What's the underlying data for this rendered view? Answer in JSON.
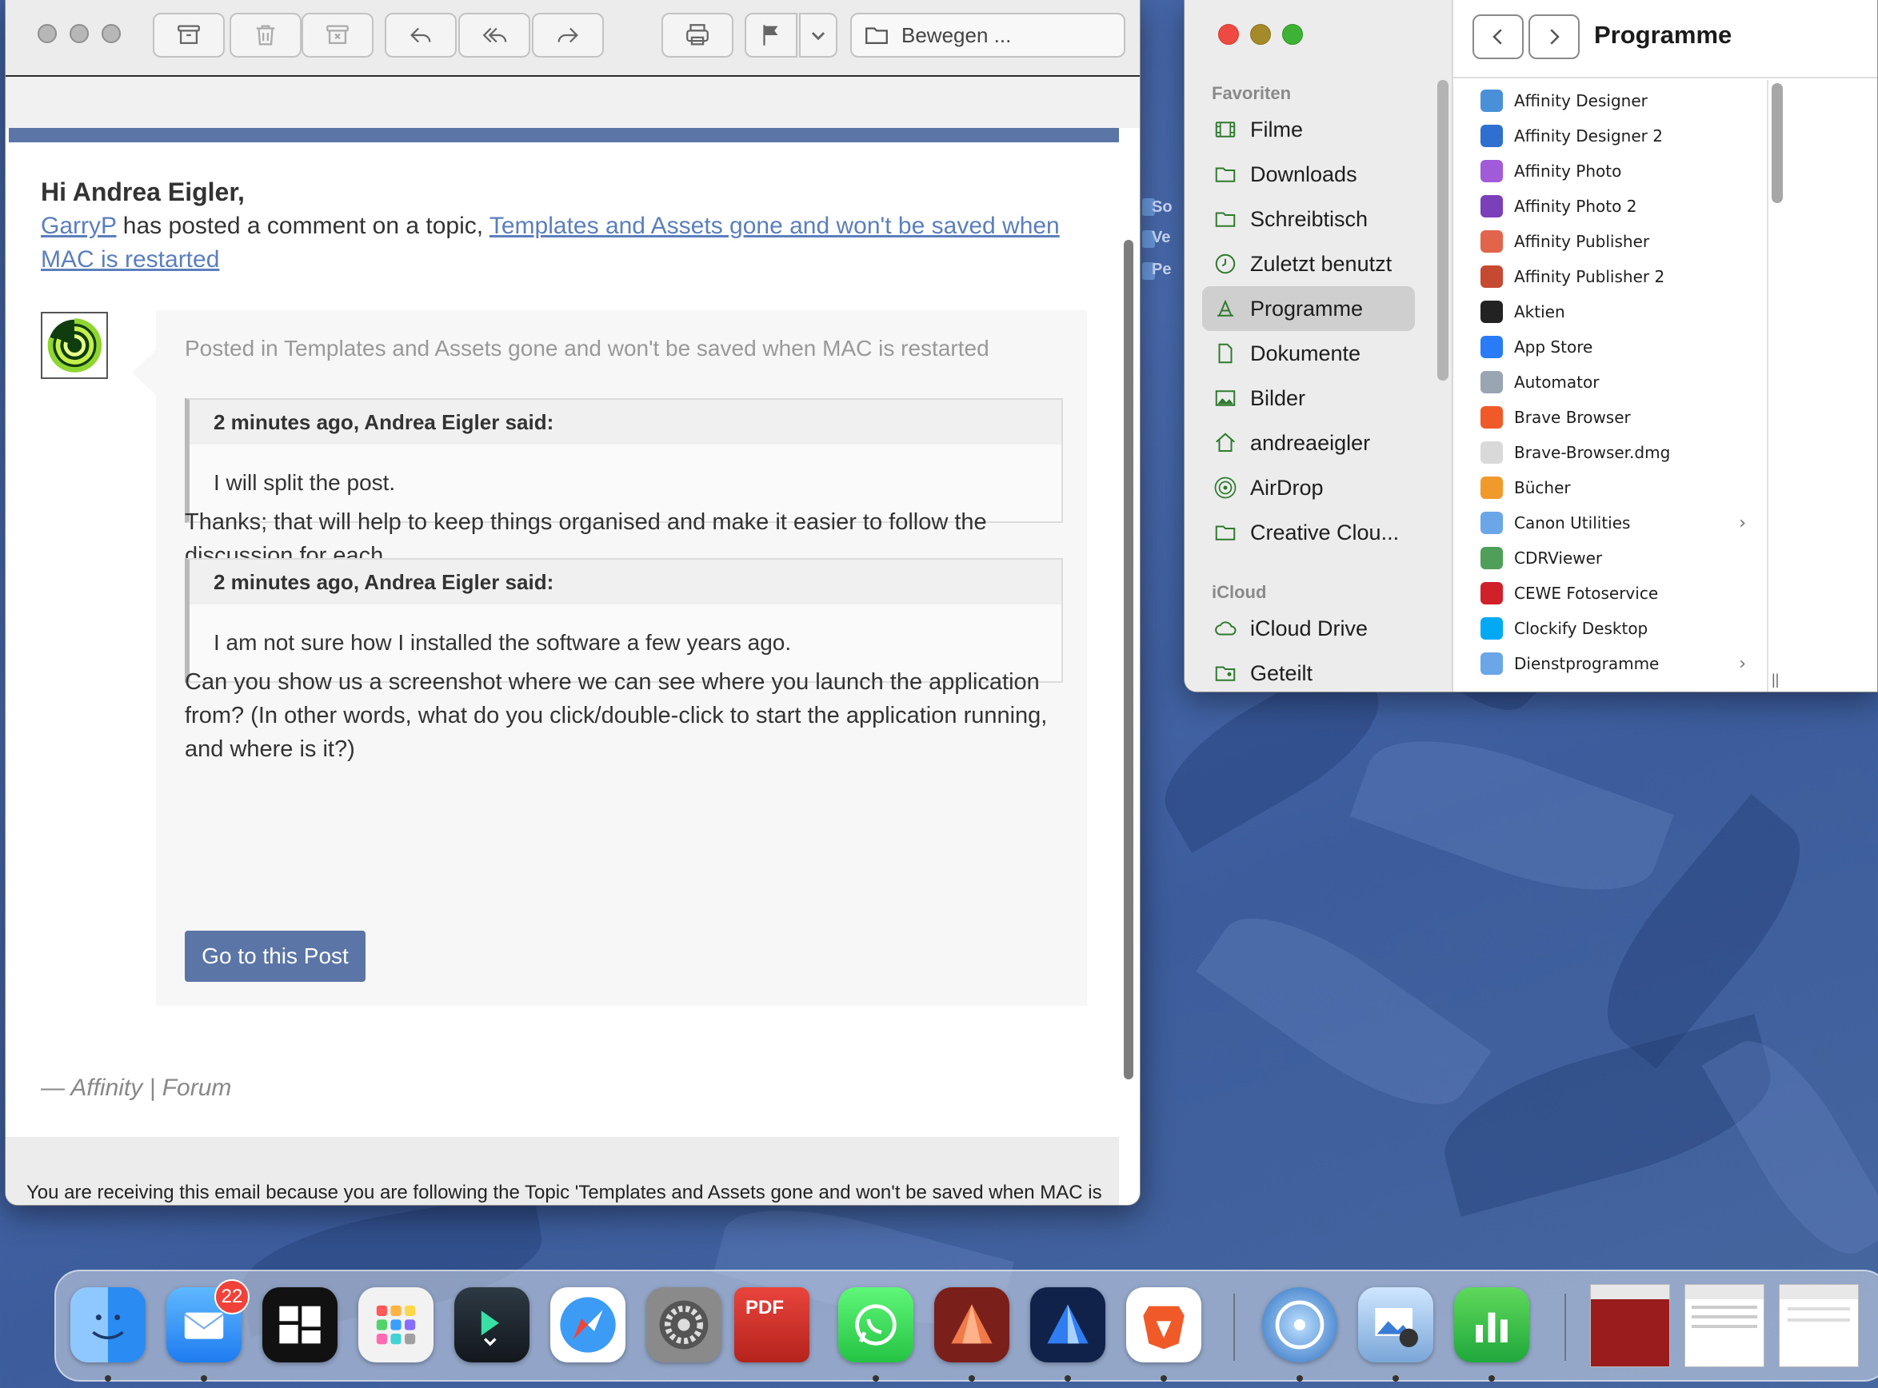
{
  "mail": {
    "toolbar": {
      "move_placeholder": "Bewegen ..."
    },
    "greeting": "Hi Andrea Eigler,",
    "intro_user": "GarryP",
    "intro_text": " has posted a comment on a topic, ",
    "intro_topic": "Templates and Assets gone and won't be saved when MAC is restarted",
    "posted_in": "Posted in Templates and Assets gone and won't be saved when MAC is restarted",
    "quote1_header": "2 minutes ago, Andrea Eigler said:",
    "quote1_body": "I will split the post.",
    "para1": "Thanks; that will help to keep things organised and make it easier to follow the discussion for each.",
    "quote2_header": "2 minutes ago, Andrea Eigler said:",
    "quote2_body": "I am not sure how I installed the software a few years ago.",
    "para2": "Can you show us a screenshot where we can see where you launch the application from? (In other words, what do you click/double-click to start the application running, and where is it?)",
    "go_button": "Go to this Post",
    "signature": "— Affinity | Forum",
    "footer": "You are receiving this email because you are following the Topic 'Templates and Assets gone and won't be saved when MAC is"
  },
  "finder": {
    "title": "Programme",
    "sections": {
      "favorites": "Favoriten",
      "icloud": "iCloud"
    },
    "sidebar": [
      {
        "label": "Filme",
        "icon": "film-icon"
      },
      {
        "label": "Downloads",
        "icon": "folder-icon"
      },
      {
        "label": "Schreibtisch",
        "icon": "folder-icon"
      },
      {
        "label": "Zuletzt benutzt",
        "icon": "clock-icon"
      },
      {
        "label": "Programme",
        "icon": "apps-icon",
        "selected": true
      },
      {
        "label": "Dokumente",
        "icon": "document-icon"
      },
      {
        "label": "Bilder",
        "icon": "photo-icon"
      },
      {
        "label": "andreaeigler",
        "icon": "home-icon"
      },
      {
        "label": "AirDrop",
        "icon": "airdrop-icon"
      },
      {
        "label": "Creative Clou...",
        "icon": "folder-icon"
      }
    ],
    "icloud_items": [
      {
        "label": "iCloud Drive",
        "icon": "cloud-icon"
      },
      {
        "label": "Geteilt",
        "icon": "shared-folder-icon"
      }
    ],
    "apps": [
      {
        "label": "Affinity Designer",
        "color": "#4a90d9"
      },
      {
        "label": "Affinity Designer 2",
        "color": "#2f6fcf"
      },
      {
        "label": "Affinity Photo",
        "color": "#a15bd9"
      },
      {
        "label": "Affinity Photo 2",
        "color": "#7b3fb9"
      },
      {
        "label": "Affinity Publisher",
        "color": "#e0654a"
      },
      {
        "label": "Affinity Publisher 2",
        "color": "#c64a32"
      },
      {
        "label": "Aktien",
        "color": "#222222"
      },
      {
        "label": "App Store",
        "color": "#2a7cf6"
      },
      {
        "label": "Automator",
        "color": "#9aa5b4"
      },
      {
        "label": "Brave Browser",
        "color": "#f05a28"
      },
      {
        "label": "Brave-Browser.dmg",
        "color": "#d9d9d9"
      },
      {
        "label": "Bücher",
        "color": "#f09a2c"
      },
      {
        "label": "Canon Utilities",
        "color": "#6aa6e8",
        "folder": true
      },
      {
        "label": "CDRViewer",
        "color": "#4f9f5a"
      },
      {
        "label": "CEWE Fotoservice",
        "color": "#d0202a"
      },
      {
        "label": "Clockify Desktop",
        "color": "#03a9f4"
      },
      {
        "label": "Dienstprogramme",
        "color": "#6aa6e8",
        "folder": true
      }
    ]
  },
  "dock": {
    "mail_badge": "22"
  }
}
